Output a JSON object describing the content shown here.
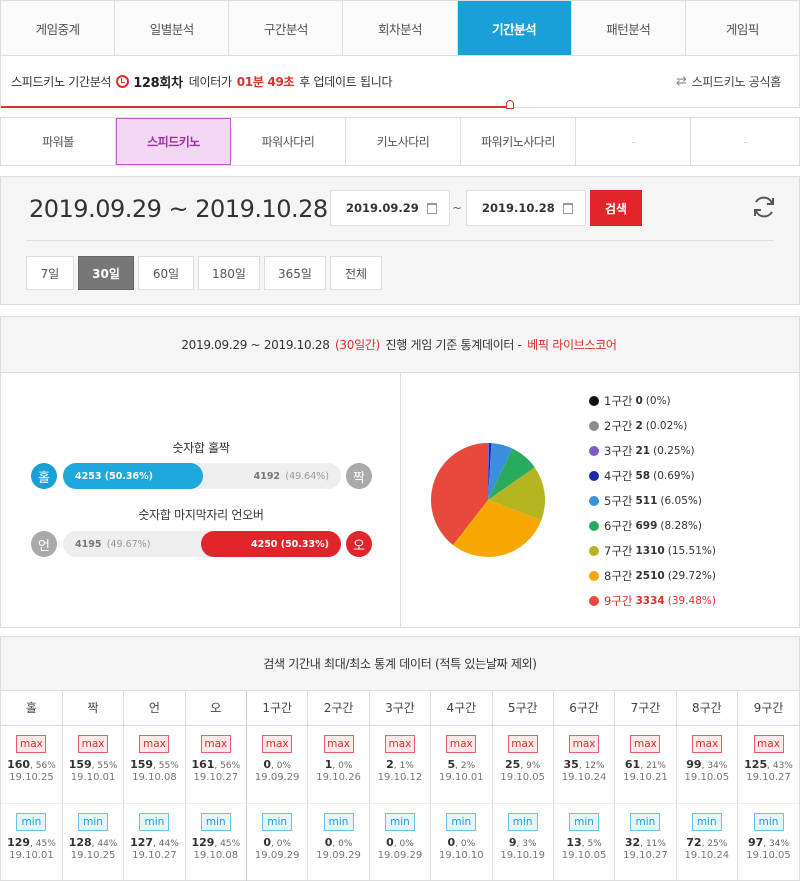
{
  "nav_tabs": [
    "게임중계",
    "일별분석",
    "구간분석",
    "회차분석",
    "기간분석",
    "패턴분석",
    "게임픽"
  ],
  "notice": {
    "prefix": "스피드키노 기간분석",
    "round": "128회차",
    "mid": "데이터가",
    "time": "01분 49초",
    "suffix": "후 업데이트 됩니다",
    "official": "스피드키노 공식홈",
    "progress": 0.64
  },
  "game_tabs": [
    "파워볼",
    "스피드키노",
    "파워사다리",
    "키노사다리",
    "파워키노사다리",
    "-",
    "-"
  ],
  "search": {
    "range": "2019.09.29 ~ 2019.10.28",
    "start": "2019.09.29",
    "tilde": "~",
    "end": "2019.10.28",
    "button": "검색",
    "periods": [
      "7일",
      "30일",
      "60일",
      "180일",
      "365일",
      "전체"
    ]
  },
  "stats": {
    "head_range": "2019.09.29 ~ 2019.10.28",
    "head_days": "(30일간)",
    "head_mid": "진행 게임 기준 통계데이터 -",
    "head_brand": "베픽 라이브스코어",
    "oddeven": {
      "title": "숫자합 홀짝",
      "left_circle": "홀",
      "right_circle": "짝",
      "left_val": "4253",
      "left_pct": "(50.36%)",
      "right_val": "4192",
      "right_pct": "(49.64%)",
      "left_share": 0.5036
    },
    "underover": {
      "title": "숫자합 마지막자리 언오버",
      "left_circle": "언",
      "right_circle": "오",
      "left_val": "4195",
      "left_pct": "(49.67%)",
      "right_val": "4250",
      "right_pct": "(50.33%)",
      "right_share": 0.5033
    },
    "segments": [
      {
        "label": "1구간",
        "count": "0",
        "pct": "(0%)",
        "value": 0,
        "color": "#111111"
      },
      {
        "label": "2구간",
        "count": "2",
        "pct": "(0.02%)",
        "value": 2,
        "color": "#8c8c8c"
      },
      {
        "label": "3구간",
        "count": "21",
        "pct": "(0.25%)",
        "value": 21,
        "color": "#7b5cc4"
      },
      {
        "label": "4구간",
        "count": "58",
        "pct": "(0.69%)",
        "value": 58,
        "color": "#1b2aa8"
      },
      {
        "label": "5구간",
        "count": "511",
        "pct": "(6.05%)",
        "value": 511,
        "color": "#3b8fdc"
      },
      {
        "label": "6구간",
        "count": "699",
        "pct": "(8.28%)",
        "value": 699,
        "color": "#29ab5f"
      },
      {
        "label": "7구간",
        "count": "1310",
        "pct": "(15.51%)",
        "value": 1310,
        "color": "#b5b521"
      },
      {
        "label": "8구간",
        "count": "2510",
        "pct": "(29.72%)",
        "value": 2510,
        "color": "#f7a800"
      },
      {
        "label": "9구간",
        "count": "3334",
        "pct": "(39.48%)",
        "value": 3334,
        "color": "#e74a3d"
      }
    ]
  },
  "minmax": {
    "title": "검색 기간내 최대/최소 통계 데이터 (적특 있는날짜 제외)",
    "max_label": "max",
    "min_label": "min",
    "columns": [
      {
        "h": "홀",
        "max": "160",
        "max_pct": "56%",
        "max_date": "19.10.25",
        "min": "129",
        "min_pct": "45%",
        "min_date": "19.10.01"
      },
      {
        "h": "짝",
        "max": "159",
        "max_pct": "55%",
        "max_date": "19.10.01",
        "min": "128",
        "min_pct": "44%",
        "min_date": "19.10.25"
      },
      {
        "h": "언",
        "max": "159",
        "max_pct": "55%",
        "max_date": "19.10.08",
        "min": "127",
        "min_pct": "44%",
        "min_date": "19.10.27"
      },
      {
        "h": "오",
        "max": "161",
        "max_pct": "56%",
        "max_date": "19.10.27",
        "min": "129",
        "min_pct": "45%",
        "min_date": "19.10.08"
      },
      {
        "h": "1구간",
        "max": "0",
        "max_pct": "0%",
        "max_date": "19.09.29",
        "min": "0",
        "min_pct": "0%",
        "min_date": "19.09.29"
      },
      {
        "h": "2구간",
        "max": "1",
        "max_pct": "0%",
        "max_date": "19.10.26",
        "min": "0",
        "min_pct": "0%",
        "min_date": "19.09.29"
      },
      {
        "h": "3구간",
        "max": "2",
        "max_pct": "1%",
        "max_date": "19.10.12",
        "min": "0",
        "min_pct": "0%",
        "min_date": "19.09.29"
      },
      {
        "h": "4구간",
        "max": "5",
        "max_pct": "2%",
        "max_date": "19.10.01",
        "min": "0",
        "min_pct": "0%",
        "min_date": "19.10.10"
      },
      {
        "h": "5구간",
        "max": "25",
        "max_pct": "9%",
        "max_date": "19.10.05",
        "min": "9",
        "min_pct": "3%",
        "min_date": "19.10.19"
      },
      {
        "h": "6구간",
        "max": "35",
        "max_pct": "12%",
        "max_date": "19.10.24",
        "min": "13",
        "min_pct": "5%",
        "min_date": "19.10.05"
      },
      {
        "h": "7구간",
        "max": "61",
        "max_pct": "21%",
        "max_date": "19.10.21",
        "min": "32",
        "min_pct": "11%",
        "min_date": "19.10.27"
      },
      {
        "h": "8구간",
        "max": "99",
        "max_pct": "34%",
        "max_date": "19.10.05",
        "min": "72",
        "min_pct": "25%",
        "min_date": "19.10.24"
      },
      {
        "h": "9구간",
        "max": "125",
        "max_pct": "43%",
        "max_date": "19.10.27",
        "min": "97",
        "min_pct": "34%",
        "min_date": "19.10.05"
      }
    ]
  }
}
